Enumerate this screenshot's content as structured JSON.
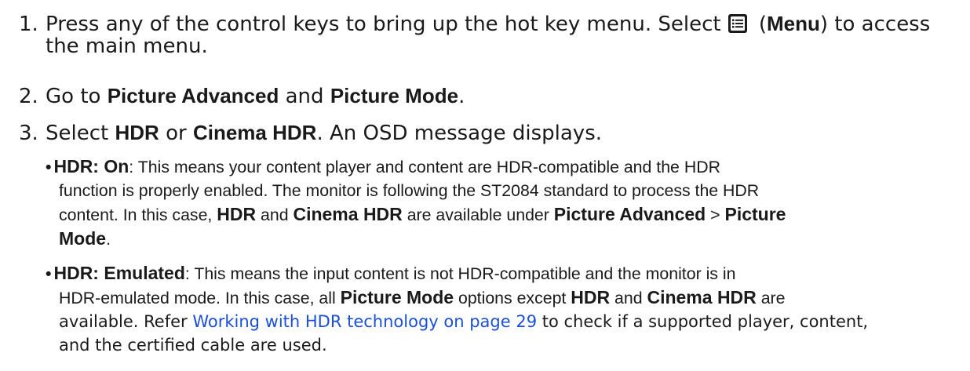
{
  "steps": [
    {
      "num": "1.",
      "line1_pre": "Press any of the control keys to bring up the hot key menu. Select",
      "menu_icon": "menu-list-icon",
      "line1_bold": "Menu",
      "line1_post": ") to access",
      "line2": "the main menu."
    },
    {
      "num": "2.",
      "pre": "Go to ",
      "bold1": "Picture Advanced",
      "mid": " and ",
      "bold2": "Picture Mode",
      "post": "."
    },
    {
      "num": "3.",
      "pre": "Select ",
      "bold1": "HDR",
      "mid": " or ",
      "bold2": "Cinema HDR",
      "post": ". An OSD message displays."
    }
  ],
  "bullets": {
    "on": {
      "label": "HDR: On",
      "l1": ": This means your content player and content are HDR-compatible and the HDR",
      "l2": "function is properly enabled. The monitor is following the ST2084 standard to process the HDR",
      "l3_pre": "content. In this case, ",
      "l3_b1": "HDR",
      "l3_mid": " and ",
      "l3_b2": "Cinema HDR",
      "l3_mid2": " are available under ",
      "l3_b3": "Picture Advanced",
      "l3_sep": " > ",
      "l3_b4": "Picture",
      "l4_b": "Mode",
      "l4_post": "."
    },
    "emulated": {
      "label": "HDR: Emulated",
      "l1": ": This means the input content is not HDR-compatible and the monitor is in",
      "l2_pre": "HDR-emulated mode. In this case, all ",
      "l2_b1": "Picture Mode",
      "l2_mid": " options except ",
      "l2_b2": "HDR",
      "l2_mid2": " and ",
      "l2_b3": "Cinema HDR",
      "l2_post": " are",
      "l3_pre": "available. Refer ",
      "l3_link": "Working with HDR technology on page 29",
      "l3_post": " to check if a supported player, content,",
      "l4": "and the certified cable are used."
    }
  },
  "colors": {
    "link": "#1c4fd8",
    "text": "#1a1a1a"
  }
}
